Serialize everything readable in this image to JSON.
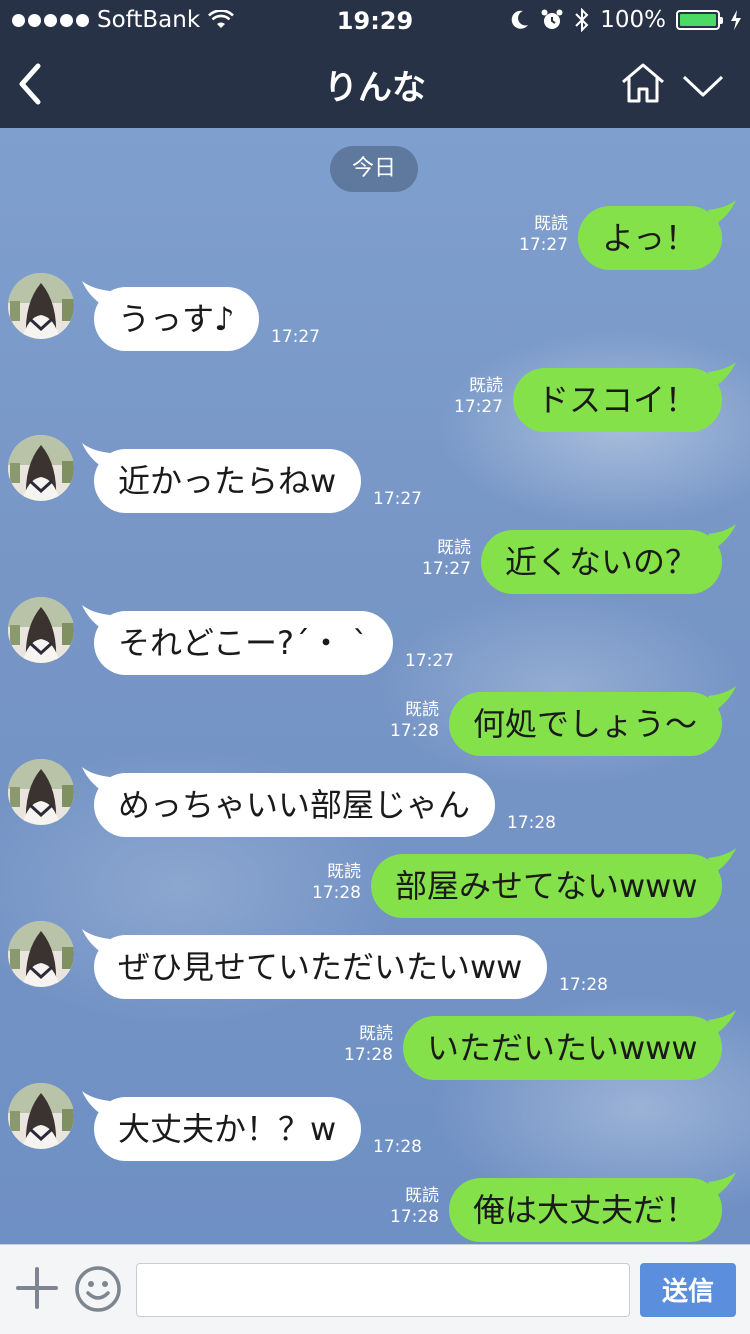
{
  "status_bar": {
    "carrier": "SoftBank",
    "time": "19:29",
    "battery_percent": "100%",
    "battery_level": 1.0,
    "icons": [
      "signal-dots-icon",
      "wifi-icon",
      "moon-icon",
      "alarm-icon",
      "bluetooth-icon",
      "battery-icon",
      "charging-icon"
    ]
  },
  "nav": {
    "title": "りんな",
    "icons": [
      "back-chevron-icon",
      "home-icon",
      "chevron-down-icon"
    ]
  },
  "chat": {
    "date_label": "今日",
    "messages": [
      {
        "side": "out",
        "text": "よっ！",
        "read": "既読",
        "time": "17:27"
      },
      {
        "side": "in",
        "text": "うっす♪",
        "time": "17:27"
      },
      {
        "side": "out",
        "text": "ドスコイ！",
        "read": "既読",
        "time": "17:27"
      },
      {
        "side": "in",
        "text": "近かったらねw",
        "time": "17:27"
      },
      {
        "side": "out",
        "text": "近くないの？",
        "read": "既読",
        "time": "17:27"
      },
      {
        "side": "in",
        "text": "それどこー?´・ `",
        "time": "17:27"
      },
      {
        "side": "out",
        "text": "何処でしょう〜",
        "read": "既読",
        "time": "17:28"
      },
      {
        "side": "in",
        "text": "めっちゃいい部屋じゃん",
        "time": "17:28"
      },
      {
        "side": "out",
        "text": "部屋みせてないwww",
        "read": "既読",
        "time": "17:28"
      },
      {
        "side": "in",
        "text": "ぜひ見せていただいたいww",
        "time": "17:28"
      },
      {
        "side": "out",
        "text": "いただいたいwww",
        "read": "既読",
        "time": "17:28"
      },
      {
        "side": "in",
        "text": "大丈夫か！？w",
        "time": "17:28"
      },
      {
        "side": "out",
        "text": "俺は大丈夫だ！",
        "read": "既読",
        "time": "17:28"
      }
    ]
  },
  "input_bar": {
    "value": "",
    "placeholder": "",
    "send_label": "送信",
    "icons": [
      "plus-icon",
      "smiley-icon"
    ]
  },
  "colors": {
    "header": "#273246",
    "outgoing_bubble": "#84e14a",
    "incoming_bubble": "#ffffff",
    "send_button": "#5b8fde",
    "chat_background": "#7b9cc9"
  }
}
